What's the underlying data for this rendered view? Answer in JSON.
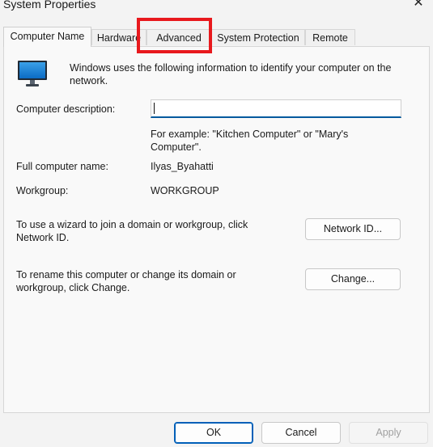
{
  "window": {
    "title": "System Properties",
    "close_glyph": "✕"
  },
  "tabs": [
    {
      "label": "Computer Name",
      "active": true
    },
    {
      "label": "Hardware",
      "active": false
    },
    {
      "label": "Advanced",
      "active": false,
      "highlighted": true
    },
    {
      "label": "System Protection",
      "active": false
    },
    {
      "label": "Remote",
      "active": false
    }
  ],
  "intro": "Windows uses the following information to identify your computer on the network.",
  "description": {
    "label": "Computer description:",
    "value": "",
    "hint": "For example: \"Kitchen Computer\" or \"Mary's Computer\"."
  },
  "full_name": {
    "label": "Full computer name:",
    "value": "Ilyas_Byahatti"
  },
  "workgroup": {
    "label": "Workgroup:",
    "value": "WORKGROUP"
  },
  "network_id": {
    "text": "To use a wizard to join a domain or workgroup, click Network ID.",
    "button": "Network ID..."
  },
  "rename": {
    "text": "To rename this computer or change its domain or workgroup, click Change.",
    "button": "Change..."
  },
  "footer": {
    "ok": "OK",
    "cancel": "Cancel",
    "apply": "Apply"
  },
  "colors": {
    "highlight": "#e8191d",
    "accent": "#005fb8"
  },
  "icons": {
    "computer": "monitor-icon",
    "close": "close-icon"
  }
}
